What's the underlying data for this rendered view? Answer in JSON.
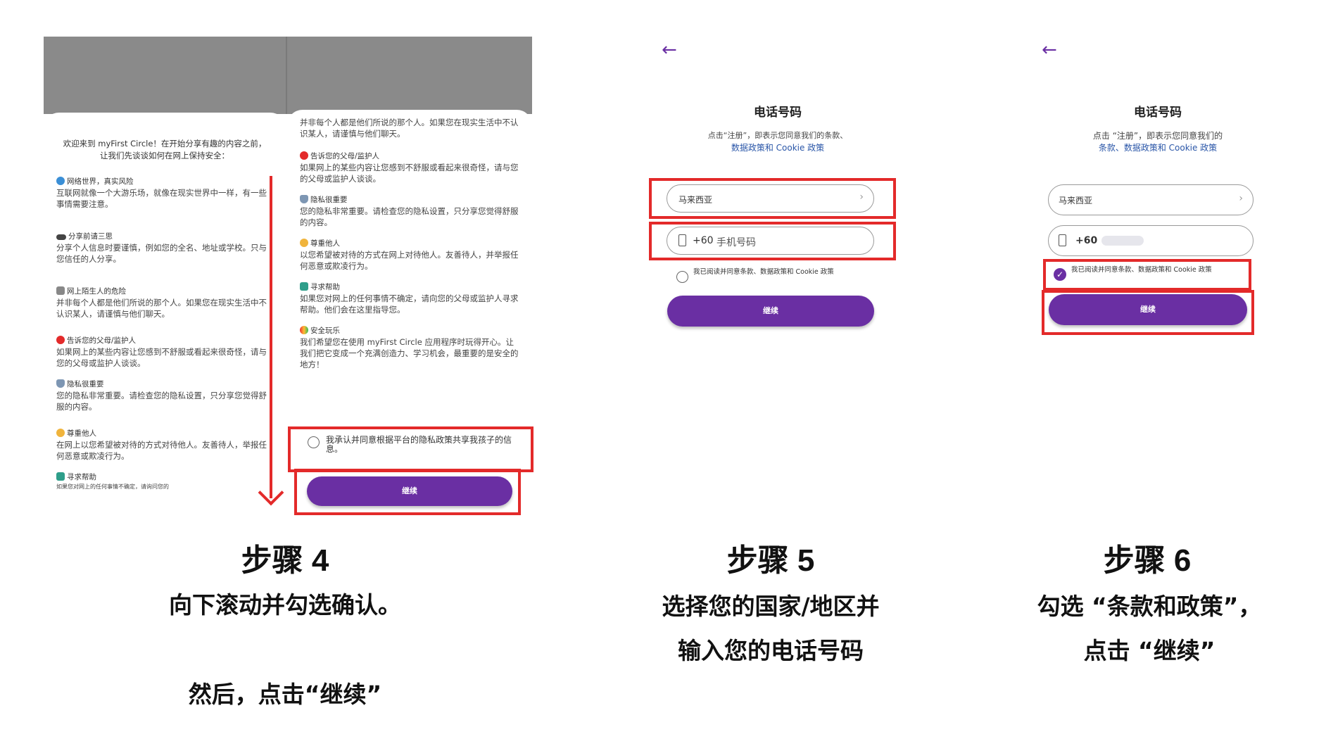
{
  "step4": {
    "title": "步骤 4",
    "caption1": "向下滚动并勾选确认。",
    "caption2": "然后，点击“继续”",
    "left": {
      "intro": "欢迎来到 myFirst Circle！在开始分享有趣的内容之前，让我们先谈谈如何在网上保持安全：",
      "sections": [
        {
          "icon": "globe-icon",
          "head": "网络世界，真实风险",
          "body": "互联网就像一个大游乐场，就像在现实世界中一样，有一些事情需要注意。"
        },
        {
          "icon": "eyes-icon",
          "head": "分享前请三思",
          "body": "分享个人信息时要谨慎，例如您的全名、地址或学校。只与您信任的人分享。"
        },
        {
          "icon": "robot-icon",
          "head": "网上陌生人的危险",
          "body": "并非每个人都是他们所说的那个人。如果您在现实生活中不认识某人，请谨慎与他们聊天。"
        },
        {
          "icon": "red-circle-icon",
          "head": "告诉您的父母/监护人",
          "body": "如果网上的某些内容让您感到不舒服或看起来很奇怪，请与您的父母或监护人谈谈。"
        },
        {
          "icon": "shield-icon",
          "head": "隐私很重要",
          "body": "您的隐私非常重要。请检查您的隐私设置，只分享您觉得舒服的内容。"
        },
        {
          "icon": "handshake-icon",
          "head": "尊重他人",
          "body": "在网上以您希望被对待的方式对待他人。友善待人，举报任何恶意或欺凌行为。"
        },
        {
          "icon": "person-icon",
          "head": "寻求帮助",
          "body": "如果您对网上的任何事情不确定，请询问您的"
        }
      ]
    },
    "right": {
      "top_body": "并非每个人都是他们所说的那个人。如果您在现实生活中不认识某人，请谨慎与他们聊天。",
      "sections": [
        {
          "icon": "red-circle-icon",
          "head": "告诉您的父母/监护人",
          "body": "如果网上的某些内容让您感到不舒服或看起来很奇怪，请与您的父母或监护人谈谈。"
        },
        {
          "icon": "shield-icon",
          "head": "隐私很重要",
          "body": "您的隐私非常重要。请检查您的隐私设置，只分享您觉得舒服的内容。"
        },
        {
          "icon": "handshake-icon",
          "head": "尊重他人",
          "body": "以您希望被对待的方式在网上对待他人。友善待人，并举报任何恶意或欺凌行为。"
        },
        {
          "icon": "person-icon",
          "head": "寻求帮助",
          "body": "如果您对网上的任何事情不确定，请向您的父母或监护人寻求帮助。他们会在这里指导您。"
        },
        {
          "icon": "rainbow-icon",
          "head": "安全玩乐",
          "body": "我们希望您在使用 myFirst Circle 应用程序时玩得开心。让我们把它变成一个充满创造力、学习机会，最重要的是安全的地方！"
        }
      ],
      "consent": "我承认并同意根据平台的隐私政策共享我孩子的信息。",
      "continue_label": "继续"
    }
  },
  "step5": {
    "title": "步骤 5",
    "caption1": "选择您的国家/地区并",
    "caption2": "输入您的电话号码",
    "screen": {
      "back_icon": "←",
      "heading": "电话号码",
      "sub": "点击“注册”，即表示您同意我们的条款、",
      "link": "数据政策和 Cookie 政策",
      "country": "马来西亚",
      "phone_prefix": "+60",
      "phone_placeholder": "手机号码",
      "consent": "我已阅读并同意条款、数据政策和 Cookie 政策",
      "continue_label": "继续"
    }
  },
  "step6": {
    "title": "步骤 6",
    "caption1": "勾选 “条款和政策”，",
    "caption2": "点击 “继续”",
    "screen": {
      "back_icon": "←",
      "heading": "电话号码",
      "sub": "点击 “注册”，即表示您同意我们的",
      "link": "条款、数据政策和 Cookie 政策",
      "country": "马来西亚",
      "phone_prefix": "+60",
      "consent": "我已阅读并同意条款、数据政策和 Cookie 政策",
      "continue_label": "继续"
    }
  },
  "colors": {
    "accent": "#6a2fa3",
    "highlight": "#e32a2a",
    "link": "#2a56a8"
  }
}
